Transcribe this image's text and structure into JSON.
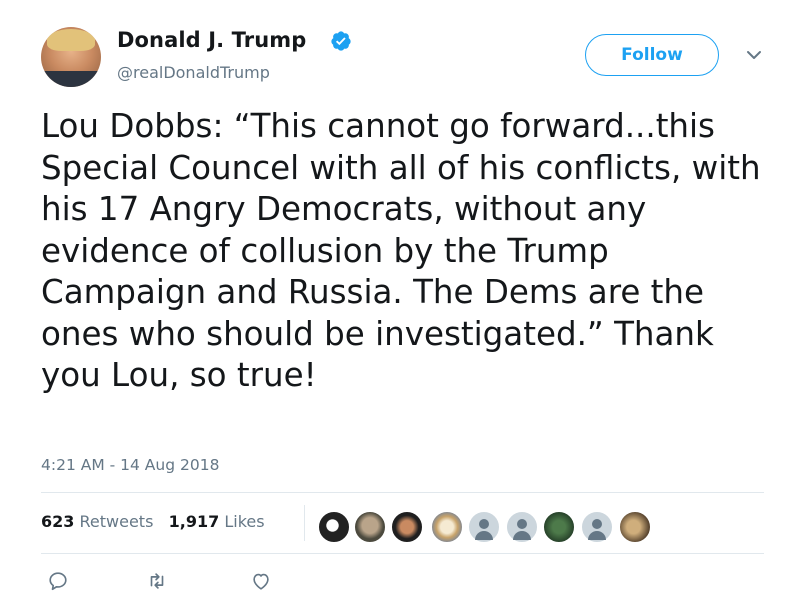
{
  "author": {
    "display_name": "Donald J. Trump",
    "handle": "@realDonaldTrump",
    "verified": true,
    "avatar_icon": "profile-photo-avatar"
  },
  "follow_button": {
    "label": "Follow"
  },
  "tweet": {
    "text": "Lou Dobbs: “This cannot go forward...this Special Councel with all of his conflicts, with his 17 Angry Democrats, without any evidence of collusion by the Trump Campaign and Russia. The Dems are the ones who should be investigated.” Thank you Lou, so true!",
    "timestamp": "4:21 AM - 14 Aug 2018"
  },
  "stats": {
    "retweets_count": "623",
    "retweets_label": "Retweets",
    "likes_count": "1,917",
    "likes_label": "Likes"
  },
  "colors": {
    "accent": "#1da1f2",
    "secondary_text": "#657786",
    "divider": "#e1e8ed"
  },
  "actions": {
    "icons": [
      "reply-icon",
      "retweet-icon",
      "like-icon"
    ]
  }
}
